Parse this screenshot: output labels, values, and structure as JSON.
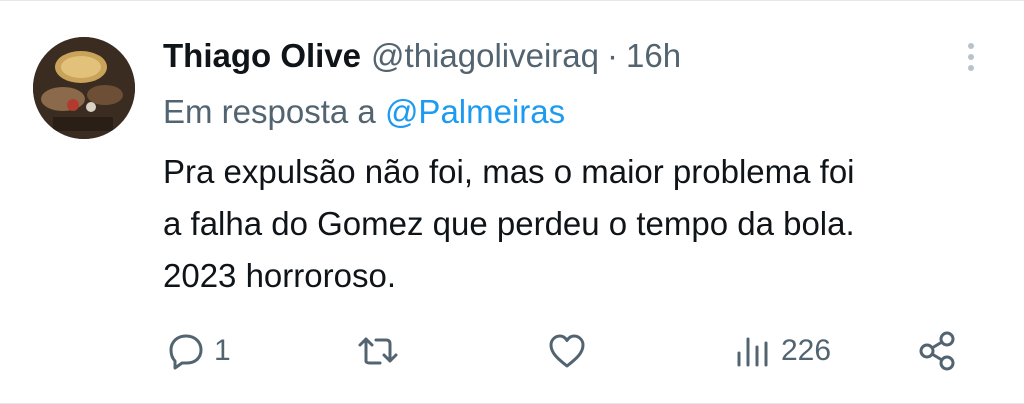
{
  "tweet": {
    "author_name": "Thiago Olive",
    "handle": "@thiagoliveiraq",
    "separator": "·",
    "time": "16h",
    "reply_prefix": "Em resposta a",
    "reply_to": "@Palmeiras",
    "text_lines": [
      "Pra expulsão não foi, mas o maior problema foi",
      "a falha do Gomez que perdeu o tempo da bola.",
      "2023 horroroso."
    ]
  },
  "actions": {
    "reply_icon": "speech-bubble-icon",
    "reply_count": "1",
    "retweet_icon": "retweet-icon",
    "like_icon": "heart-icon",
    "views_icon": "bar-chart-icon",
    "views_count": "226",
    "share_icon": "share-nodes-icon"
  },
  "colors": {
    "text": "#0f1419",
    "secondary": "#536471",
    "accent": "#1d9bf0",
    "divider": "#e6e9ec"
  }
}
